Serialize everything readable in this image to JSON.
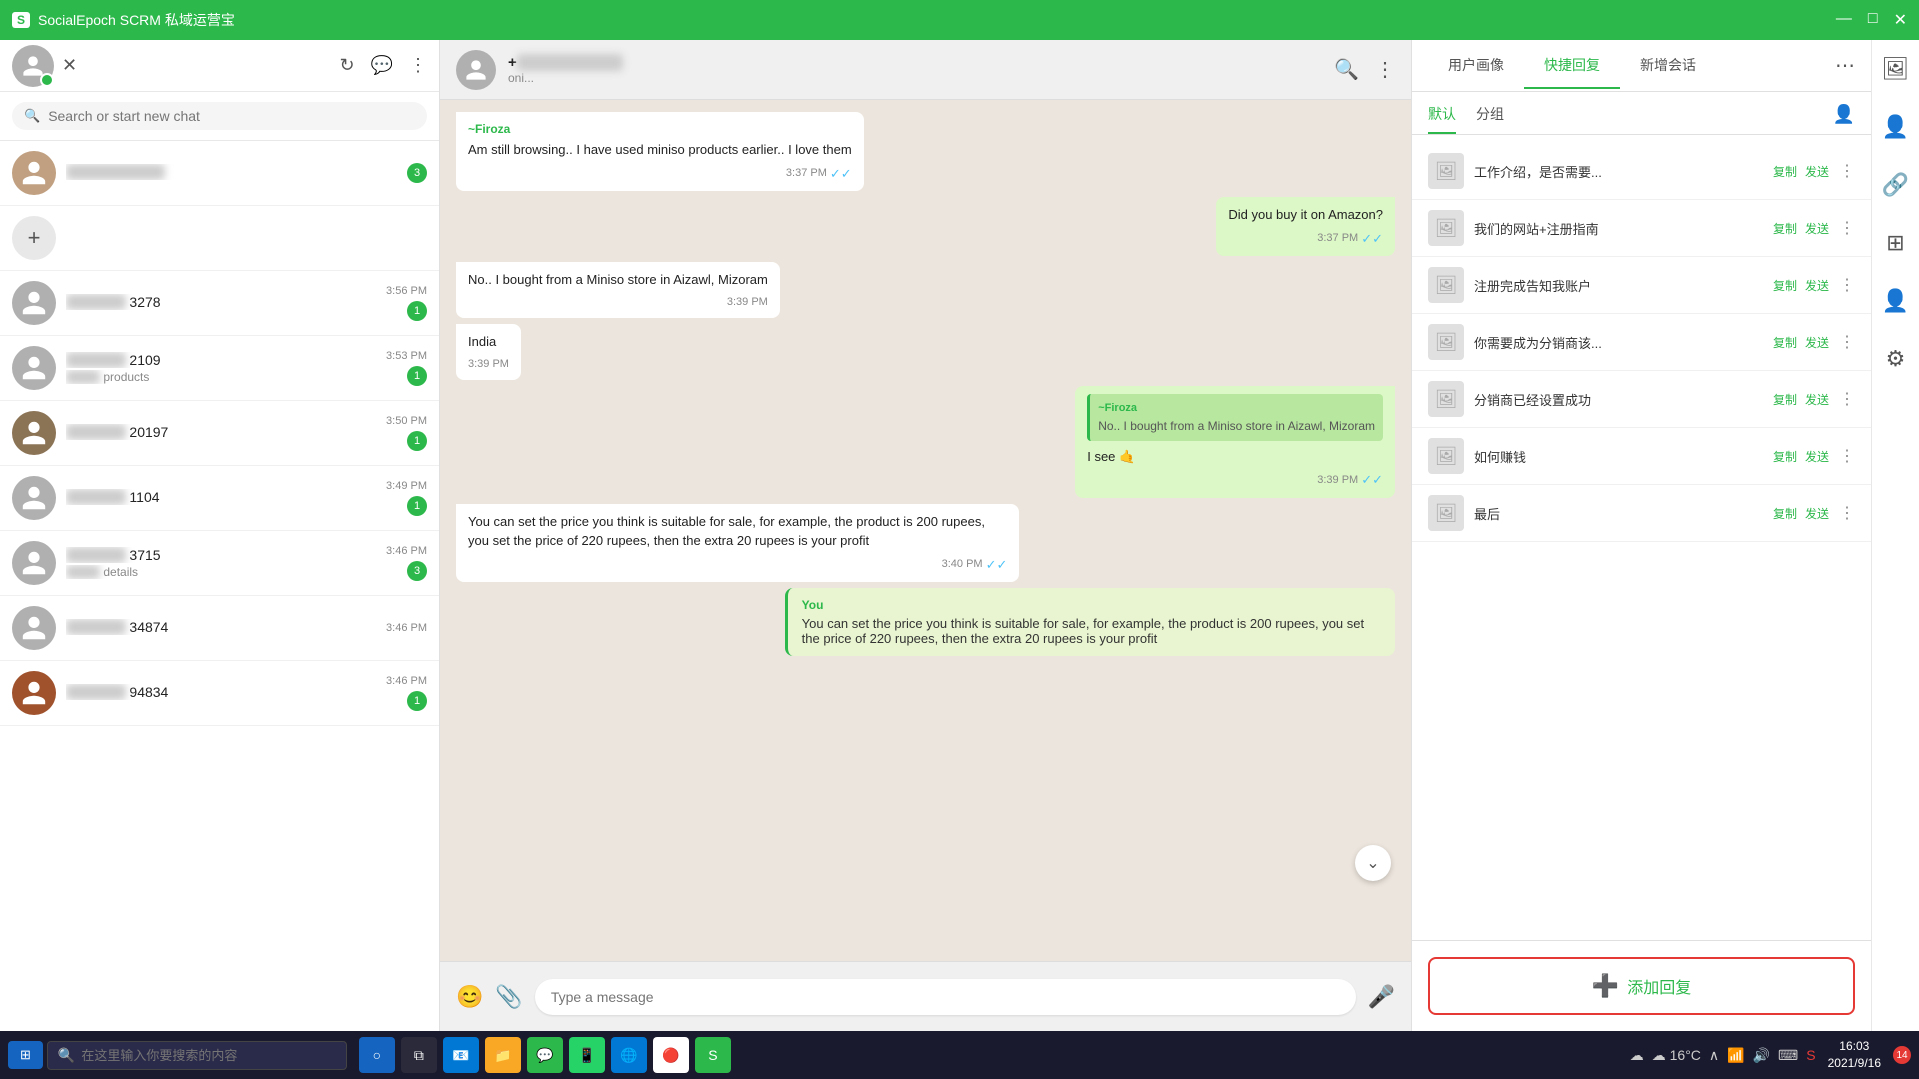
{
  "titleBar": {
    "title": "SocialEpoch SCRM 私域运营宝",
    "minimize": "—",
    "maximize": "□",
    "close": "✕"
  },
  "sidebar": {
    "searchPlaceholder": "Search or start new chat",
    "contacts": [
      {
        "id": 1,
        "name": "████ 3278",
        "msg": "",
        "time": "3:56 PM",
        "badge": "1",
        "hasAvatar": false
      },
      {
        "id": 2,
        "name": "████ 2109",
        "msg": "████ products",
        "time": "3:53 PM",
        "badge": "1",
        "hasAvatar": false
      },
      {
        "id": 3,
        "name": "████ 20197",
        "msg": "",
        "time": "3:50 PM",
        "badge": "1",
        "hasAvatar": true
      },
      {
        "id": 4,
        "name": "████ 1104",
        "msg": "",
        "time": "3:49 PM",
        "badge": "1",
        "hasAvatar": false
      },
      {
        "id": 5,
        "name": "████ 3715",
        "msg": "████ details",
        "time": "3:46 PM",
        "badge": "3",
        "hasAvatar": false
      },
      {
        "id": 6,
        "name": "████ 34874",
        "msg": "",
        "time": "3:46 PM",
        "badge": "0",
        "hasAvatar": false
      },
      {
        "id": 7,
        "name": "████ 94834",
        "msg": "",
        "time": "3:46 PM",
        "badge": "1",
        "hasAvatar": true
      }
    ],
    "addLabel": "+"
  },
  "chatHeader": {
    "name": "+██████████",
    "status": "oni...",
    "searchIcon": "🔍",
    "moreIcon": "⋮"
  },
  "messages": [
    {
      "id": 1,
      "type": "incoming",
      "sender": "~Firoza",
      "showSender": true,
      "text": "Am still browsing.. I have used miniso products earlier.. I love them",
      "time": "3:37 PM",
      "ticks": "✓✓"
    },
    {
      "id": 2,
      "type": "outgoing",
      "text": "Did you buy it on Amazon?",
      "time": "3:37 PM",
      "ticks": "✓✓"
    },
    {
      "id": 3,
      "type": "incoming",
      "showSender": false,
      "text": "No.. I bought from a Miniso store in Aizawl, Mizoram",
      "time": "3:39 PM"
    },
    {
      "id": 4,
      "type": "incoming",
      "showSender": false,
      "text": "India",
      "time": "3:39 PM"
    },
    {
      "id": 5,
      "type": "outgoing",
      "sender": "",
      "showSender": true,
      "senderLabel": "~Firoza",
      "quotedText": "No.. I bought from a Miniso store in Aizawl, Mizoram",
      "text": "I see 🤙",
      "time": "3:39 PM",
      "ticks": "✓✓"
    },
    {
      "id": 6,
      "type": "incoming",
      "showSender": false,
      "text": "You can set the price you think is suitable for sale, for example, the product is 200 rupees, you set the price of 220 rupees, then the extra 20 rupees is your profit",
      "time": "3:40 PM",
      "ticks": "✓✓"
    },
    {
      "id": 7,
      "type": "you-preview",
      "youLabel": "You",
      "text": "You can set the price you think is suitable for sale, for example, the product is 200 rupees, you set the price of 220 rupees, then the extra 20 rupees is your profit"
    }
  ],
  "input": {
    "placeholder": "Type a message",
    "emojiIcon": "😊",
    "attachIcon": "📎",
    "micIcon": "🎤"
  },
  "rightPanel": {
    "tabs": [
      "用户画像",
      "快捷回复",
      "新增会话"
    ],
    "activeTab": "快捷回复",
    "moreIcon": "⋯",
    "subTabs": [
      "默认",
      "分组"
    ],
    "activeSubTab": "默认",
    "quickReplies": [
      {
        "id": 1,
        "text": "工作介绍，是否需要...",
        "copy": "复制",
        "send": "发送"
      },
      {
        "id": 2,
        "text": "我们的网站+注册指南",
        "copy": "复制",
        "send": "发送"
      },
      {
        "id": 3,
        "text": "注册完成告知我账户",
        "copy": "复制",
        "send": "发送"
      },
      {
        "id": 4,
        "text": "你需要成为分销商该...",
        "copy": "复制",
        "send": "发送"
      },
      {
        "id": 5,
        "text": "分销商已经设置成功",
        "copy": "复制",
        "send": "发送"
      },
      {
        "id": 6,
        "text": "如何赚钱",
        "copy": "复制",
        "send": "发送"
      },
      {
        "id": 7,
        "text": "最后",
        "copy": "复制",
        "send": "发送"
      }
    ],
    "addReplyLabel": "添加回复",
    "addIcon": "+"
  },
  "sideIcons": [
    "🖼",
    "👤",
    "🔗",
    "☰",
    "👤",
    "⚙"
  ],
  "taskbar": {
    "startLabel": "⊞",
    "searchPlaceholder": "在这里输入你要搜索的内容",
    "time": "16:03",
    "date": "2021/9/16",
    "weather": "☁ 16°C",
    "notificationBadge": "14"
  }
}
